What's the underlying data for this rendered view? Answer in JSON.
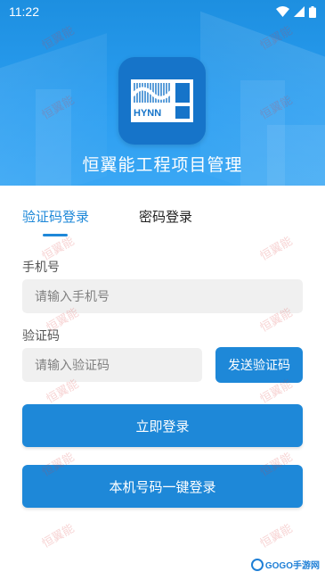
{
  "status_bar": {
    "time": "11:22"
  },
  "header": {
    "logo_text": "HYNN",
    "app_title": "恒翼能工程项目管理"
  },
  "tabs": [
    {
      "label": "验证码登录",
      "active": true
    },
    {
      "label": "密码登录",
      "active": false
    }
  ],
  "phone": {
    "label": "手机号",
    "placeholder": "请输入手机号"
  },
  "code": {
    "label": "验证码",
    "placeholder": "请输入验证码",
    "send_label": "发送验证码"
  },
  "buttons": {
    "login": "立即登录",
    "one_click": "本机号码一键登录"
  },
  "watermark": "恒翼能",
  "corner_badge": "GOGO手游网",
  "colors": {
    "accent": "#1e88d8",
    "header": "#2a9df0",
    "logo_bg": "#1674c9"
  }
}
